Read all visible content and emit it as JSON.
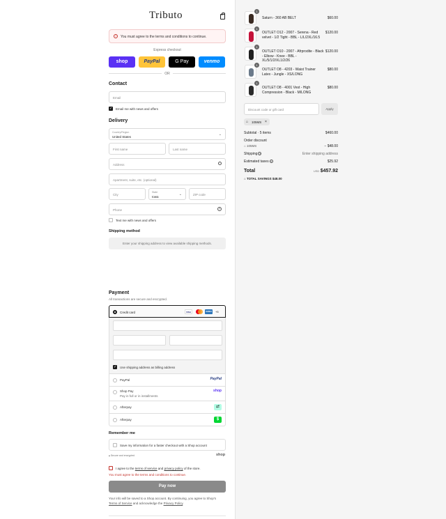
{
  "brand": {
    "logo": "Tributo"
  },
  "alert": {
    "message": "You must agree to the terms and conditions to continue."
  },
  "express": {
    "label": "Express checkout",
    "shop": "shop",
    "paypal": "PayPal",
    "gpay": "G Pay",
    "venmo": "venmo",
    "or": "OR"
  },
  "contact": {
    "heading": "Contact",
    "email_placeholder": "Email",
    "news_label": "Email me with news and offers"
  },
  "delivery": {
    "heading": "Delivery",
    "country_label": "Country/Region",
    "country_value": "United States",
    "first_name": "First name",
    "last_name": "Last name",
    "address": "Address",
    "apartment": "Apartment, suite, etc. (optional)",
    "city": "City",
    "state_label": "State",
    "state_value": "Iowa",
    "zip": "ZIP code",
    "phone": "Phone",
    "text_offers": "Text me with news and offers"
  },
  "shipping": {
    "heading": "Shipping method",
    "message": "Enter your shipping address to view available shipping methods."
  },
  "payment": {
    "heading": "Payment",
    "subtitle": "All transactions are secure and encrypted.",
    "credit_card": "Credit card",
    "card_more": "+5",
    "billing_label": "Use shipping address as billing address",
    "methods": [
      {
        "label": "PayPal",
        "sub": "",
        "badge": "PayPal"
      },
      {
        "label": "Shop Pay",
        "sub": "Pay in full or in installments",
        "badge": "shop"
      },
      {
        "label": "Afterpay",
        "sub": "",
        "badge": ""
      },
      {
        "label": "Afterpay",
        "sub": "",
        "badge": "$"
      }
    ]
  },
  "remember": {
    "heading": "Remember me",
    "save_label": "Save my information for a faster checkout with a Shop account",
    "secure": "Secure and encrypted",
    "shop_logo": "shop"
  },
  "terms": {
    "prefix": "I agree to the ",
    "tos": "terms of service",
    "mid": " and ",
    "privacy": "privacy policy",
    "suffix": " of the store.",
    "error": "You must agree to the terms and conditions to continue."
  },
  "pay_now": "Pay now",
  "footer": {
    "line1": "Your info will be saved to a Shop account. By continuing, you agree to Shop's",
    "tos": "Terms of Service",
    "mid": " and acknowledge the ",
    "privacy": "Privacy Policy",
    "end": "."
  },
  "cart": {
    "items": [
      {
        "qty": "1",
        "name": "Saturn - 360 AB BELT",
        "price": "$60.00"
      },
      {
        "qty": "1",
        "name": "OUTLET O12 - 2007 - Serena - Red velvet - 1/2 Tight - BBL - L/L/2XL/16.5",
        "price": "$120.00"
      },
      {
        "qty": "1",
        "name": "OUTLET O10 - 2007 - Afrprodite - Black - Elbow - Knee - BBL - XL/5/1/2/XL1/2/26",
        "price": "$120.00"
      },
      {
        "qty": "1",
        "name": "OUTLET O8 - 4203 - Waist Trainer Latex - Jungle - XS/LONG",
        "price": "$80.00"
      },
      {
        "qty": "1",
        "name": "OUTLET O8 - 4001 Vest - High Compression - Black - M/LONG",
        "price": "$80.00"
      }
    ],
    "discount_placeholder": "Discount code or gift card",
    "apply": "Apply",
    "tag": "105MS"
  },
  "summary": {
    "subtotal_label": "Subtotal · 5 items",
    "subtotal_value": "$460.00",
    "order_discount": "Order discount",
    "discount_code": "105MS",
    "discount_value": "− $48.00",
    "shipping_label": "Shipping",
    "shipping_value": "Enter shipping address",
    "taxes_label": "Estimated taxes",
    "taxes_value": "$25.92",
    "total_label": "Total",
    "currency": "USD",
    "total_value": "$457.92",
    "savings_label": "TOTAL SAVINGS",
    "savings_value": "$48.00"
  },
  "colors": {
    "shop": "#5a31f4",
    "paypal": "#ffc439",
    "gpay": "#000000",
    "venmo": "#008cff",
    "error": "#c4322b"
  }
}
